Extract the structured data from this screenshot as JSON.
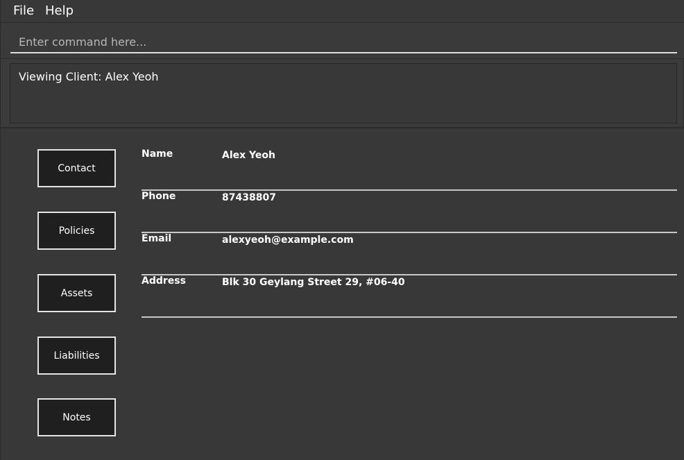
{
  "menubar": {
    "file_label": "File",
    "help_label": "Help"
  },
  "command": {
    "placeholder": "Enter command here...",
    "value": ""
  },
  "result": {
    "text": "Viewing Client: Alex Yeoh"
  },
  "tabs": [
    {
      "label": "Contact"
    },
    {
      "label": "Policies"
    },
    {
      "label": "Assets"
    },
    {
      "label": "Liabilities"
    },
    {
      "label": "Notes"
    }
  ],
  "client": {
    "fields": [
      {
        "label": "Name",
        "value": "Alex Yeoh"
      },
      {
        "label": "Phone",
        "value": "87438807"
      },
      {
        "label": "Email",
        "value": "alexyeoh@example.com"
      },
      {
        "label": "Address",
        "value": "Blk 30 Geylang Street 29, #06-40"
      }
    ]
  }
}
